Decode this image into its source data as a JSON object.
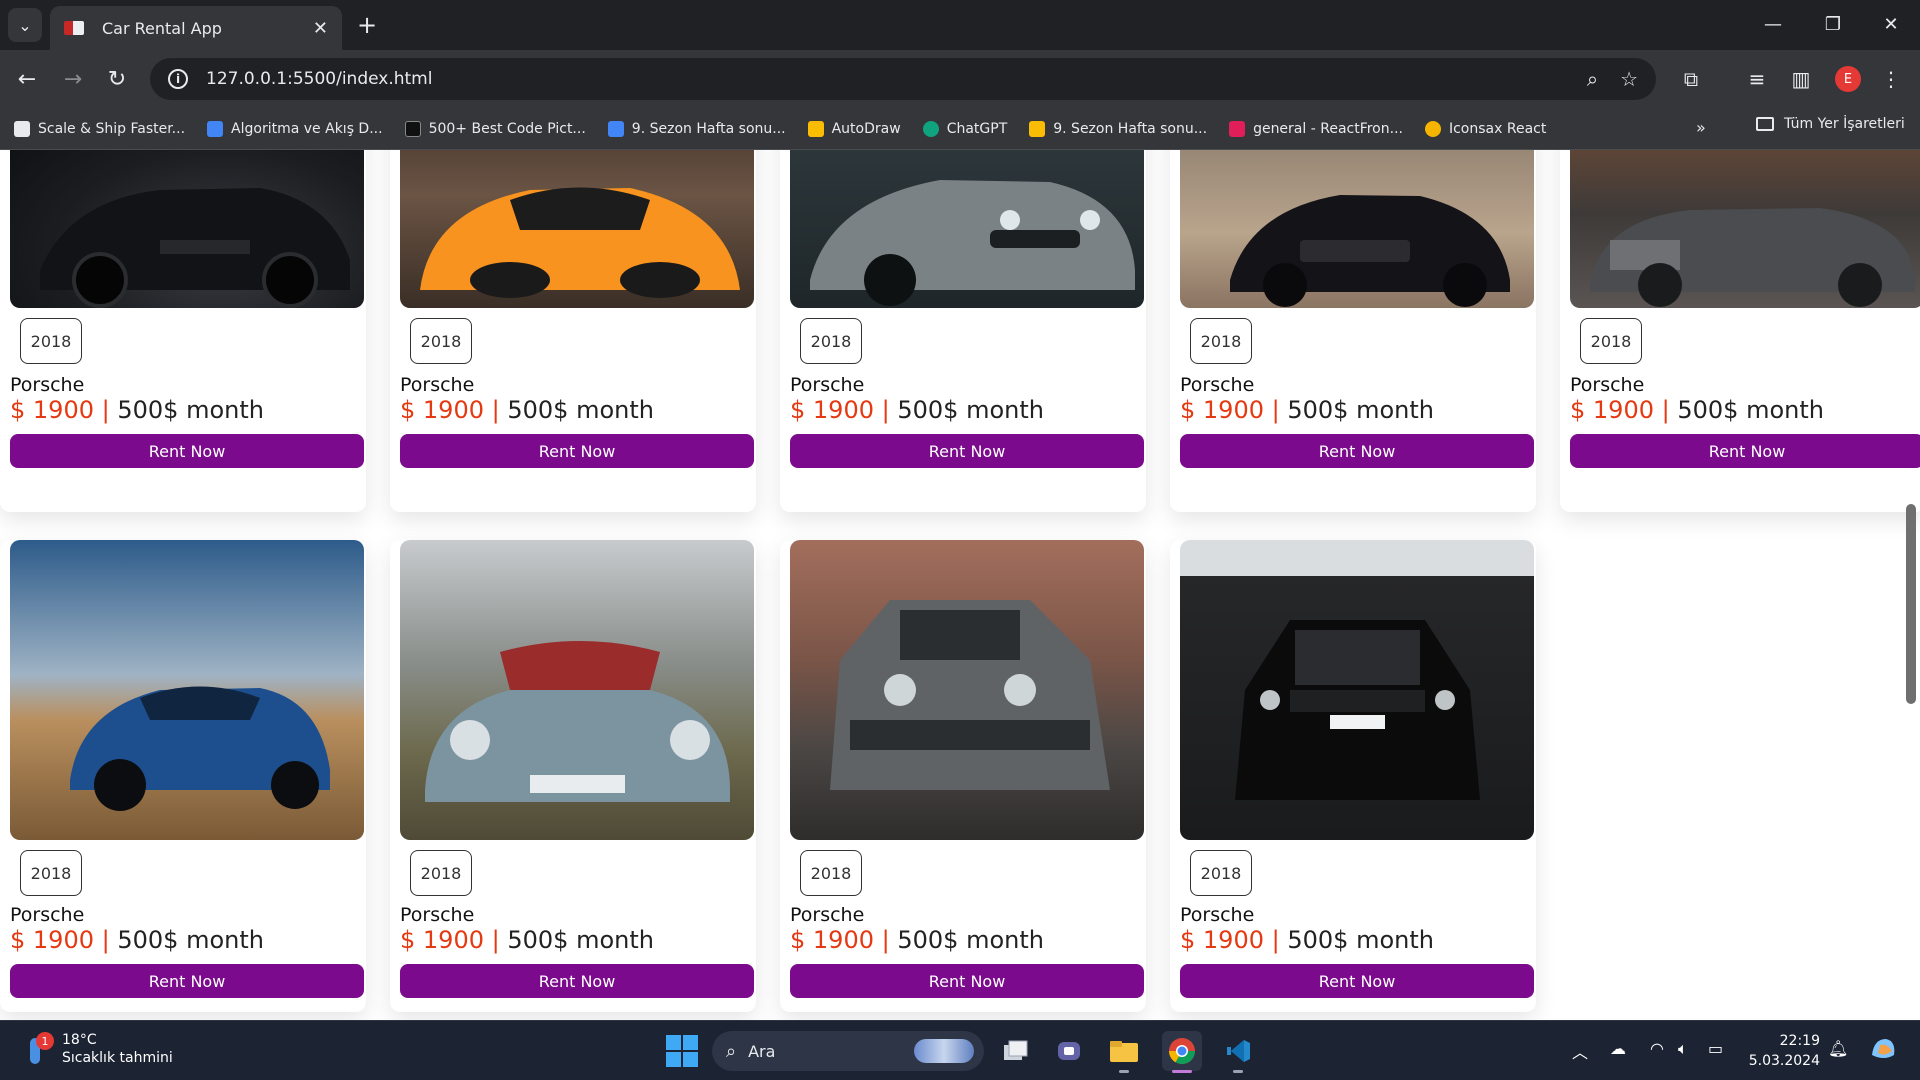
{
  "browser": {
    "tab_title": "Car Rental App",
    "url": "127.0.0.1:5500/index.html",
    "profile_initial": "E",
    "bookmarks": [
      {
        "label": "Scale & Ship Faster...",
        "color": "#e8eaed"
      },
      {
        "label": "Algoritma ve Akış D...",
        "color": "#4285f4"
      },
      {
        "label": "500+ Best Code Pict...",
        "color": "#222222"
      },
      {
        "label": "9. Sezon Hafta sonu...",
        "color": "#4285f4"
      },
      {
        "label": "AutoDraw",
        "color": "#fbbc04"
      },
      {
        "label": "ChatGPT",
        "color": "#10a37f"
      },
      {
        "label": "9. Sezon Hafta sonu...",
        "color": "#fbbc04"
      },
      {
        "label": "general - ReactFron...",
        "color": "#e01e5a"
      },
      {
        "label": "Iconsax React",
        "color": "#f4b400"
      }
    ],
    "all_bookmarks_label": "Tüm Yer İşaretleri"
  },
  "cars": [
    {
      "year": "2018",
      "name": "Porsche",
      "price": "$ 1900",
      "separator": "|",
      "monthly": "500$ month",
      "button": "Rent Now",
      "car": "black-honda-civic"
    },
    {
      "year": "2018",
      "name": "Porsche",
      "price": "$ 1900",
      "separator": "|",
      "monthly": "500$ month",
      "button": "Rent Now",
      "car": "orange-porsche"
    },
    {
      "year": "2018",
      "name": "Porsche",
      "price": "$ 1900",
      "separator": "|",
      "monthly": "500$ month",
      "button": "Rent Now",
      "car": "grey-bmw"
    },
    {
      "year": "2018",
      "name": "Porsche",
      "price": "$ 1900",
      "separator": "|",
      "monthly": "500$ month",
      "button": "Rent Now",
      "car": "black-mercedes-sedan"
    },
    {
      "year": "2018",
      "name": "Porsche",
      "price": "$ 1900",
      "separator": "|",
      "monthly": "500$ month",
      "button": "Rent Now",
      "car": "rolls-royce-convertible"
    },
    {
      "year": "2018",
      "name": "Porsche",
      "price": "$ 1900",
      "separator": "|",
      "monthly": "500$ month",
      "button": "Rent Now",
      "car": "blue-volvo-suv"
    },
    {
      "year": "2018",
      "name": "Porsche",
      "price": "$ 1900",
      "separator": "|",
      "monthly": "500$ month",
      "button": "Rent Now",
      "car": "classic-mercedes"
    },
    {
      "year": "2018",
      "name": "Porsche",
      "price": "$ 1900",
      "separator": "|",
      "monthly": "500$ month",
      "button": "Rent Now",
      "car": "mercedes-g-class"
    },
    {
      "year": "2018",
      "name": "Porsche",
      "price": "$ 1900",
      "separator": "|",
      "monthly": "500$ month",
      "button": "Rent Now",
      "car": "black-range-rover"
    }
  ],
  "colors": {
    "accent_button": "#7b0a8c",
    "price_red": "#e53912"
  },
  "taskbar": {
    "temperature": "18°C",
    "weather_label": "Sıcaklık tahmini",
    "weather_badge": "1",
    "search_label": "Ara",
    "time": "22:19",
    "date": "5.03.2024"
  }
}
